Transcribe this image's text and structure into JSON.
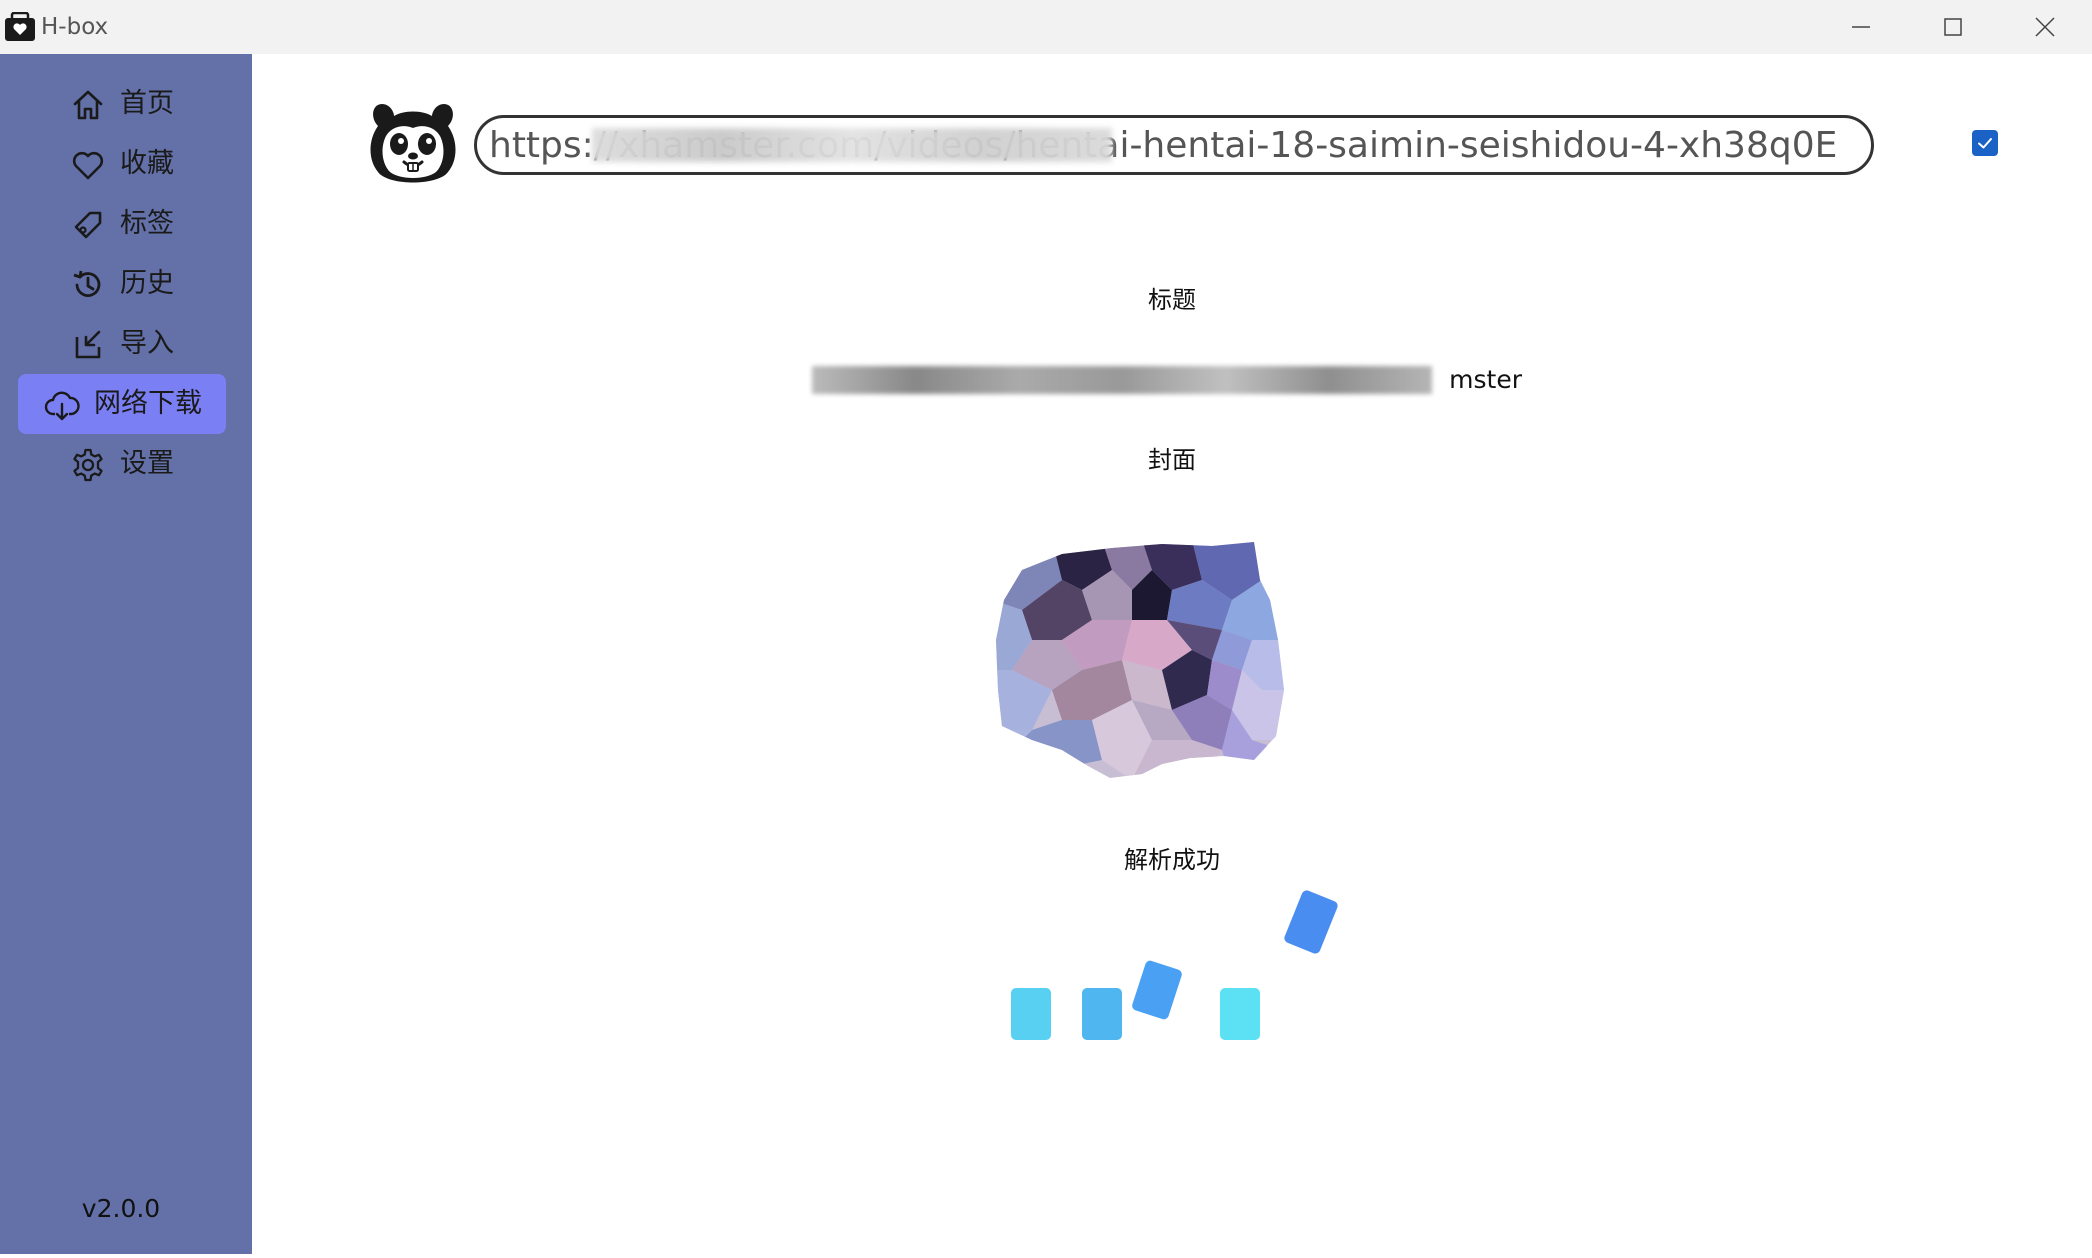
{
  "window": {
    "title": "H-box",
    "controls": [
      "minimize-icon",
      "maximize-icon",
      "close-icon"
    ]
  },
  "sidebar": {
    "items": [
      {
        "label": "首页",
        "icon": "home-icon"
      },
      {
        "label": "收藏",
        "icon": "heart-icon"
      },
      {
        "label": "标签",
        "icon": "tag-icon"
      },
      {
        "label": "历史",
        "icon": "history-icon"
      },
      {
        "label": "导入",
        "icon": "import-icon"
      },
      {
        "label": "网络下载",
        "icon": "cloud-download-icon",
        "active": true
      },
      {
        "label": "设置",
        "icon": "gear-icon"
      }
    ],
    "version": "v2.0.0"
  },
  "main": {
    "url": "https://xhamster.com/videos/hentai-hentai-18-saimin-seishidou-4-xh38q0E",
    "checkbox_checked": true,
    "title_label": "标题",
    "title_value": "mster",
    "cover_label": "封面",
    "status_text": "解析成功"
  },
  "colors": {
    "sidebar_bg": "#6371a8",
    "active_item_bg": "#7b7ff4",
    "checkbox": "#1a62c5",
    "loader": [
      "#57d0f2",
      "#4fb6f0",
      "#4aa0f2",
      "#5be1f3",
      "#4a8df0"
    ]
  }
}
